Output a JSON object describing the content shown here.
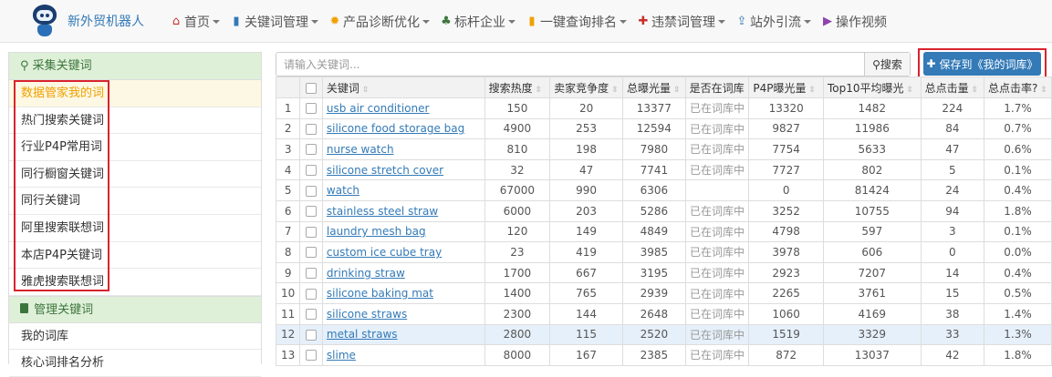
{
  "brand": {
    "name": "新外贸机器人"
  },
  "nav": [
    {
      "label": "首页",
      "icon": "home-icon",
      "glyph": "⌂",
      "color": "#c9302c",
      "caret": true
    },
    {
      "label": "关键词管理",
      "icon": "book-icon",
      "glyph": "▮",
      "color": "#337ab7",
      "caret": true
    },
    {
      "label": "产品诊断优化",
      "icon": "fire-icon",
      "glyph": "✹",
      "color": "#f0a000",
      "caret": true
    },
    {
      "label": "标杆企业",
      "icon": "tree-icon",
      "glyph": "♣",
      "color": "#3c763d",
      "caret": true
    },
    {
      "label": "一键查询排名",
      "icon": "signal-icon",
      "glyph": "▮",
      "color": "#f0a000",
      "caret": true
    },
    {
      "label": "违禁词管理",
      "icon": "medkit-icon",
      "glyph": "✚",
      "color": "#c9302c",
      "caret": true
    },
    {
      "label": "站外引流",
      "icon": "upload-icon",
      "glyph": "⇪",
      "color": "#337ab7",
      "caret": true
    },
    {
      "label": "操作视频",
      "icon": "play-icon",
      "glyph": "▶",
      "color": "#8e44ad",
      "caret": false
    }
  ],
  "sidebar": {
    "collect_title": "采集关键词",
    "collect_items": [
      "数据管家我的词",
      "热门搜索关键词",
      "行业P4P常用词",
      "同行橱窗关键词",
      "同行关键词",
      "阿里搜索联想词",
      "本店P4P关键词",
      "雅虎搜索联想词"
    ],
    "manage_title": "管理关键词",
    "manage_items": [
      "我的词库",
      "核心词排名分析"
    ]
  },
  "search": {
    "placeholder": "请输入关键词...",
    "button": "搜索"
  },
  "save_button": "保存到《我的词库》",
  "table": {
    "columns": [
      "关键词",
      "搜索热度",
      "卖家竞争度",
      "总曝光量",
      "是否在词库",
      "P4P曝光量",
      "Top10平均曝光",
      "总点击量",
      "总点击率?"
    ],
    "rows": [
      [
        "1",
        "usb air conditioner",
        "150",
        "20",
        "13377",
        "已在词库中",
        "13320",
        "1482",
        "224",
        "1.7%"
      ],
      [
        "2",
        "silicone food storage bag",
        "4900",
        "253",
        "12594",
        "已在词库中",
        "9827",
        "11986",
        "84",
        "0.7%"
      ],
      [
        "3",
        "nurse watch",
        "810",
        "198",
        "7980",
        "已在词库中",
        "7754",
        "5633",
        "47",
        "0.6%"
      ],
      [
        "4",
        "silicone stretch cover",
        "32",
        "47",
        "7741",
        "已在词库中",
        "7727",
        "802",
        "5",
        "0.1%"
      ],
      [
        "5",
        "watch",
        "67000",
        "990",
        "6306",
        "",
        "0",
        "81424",
        "24",
        "0.4%"
      ],
      [
        "6",
        "stainless steel straw",
        "6000",
        "203",
        "5286",
        "已在词库中",
        "3252",
        "10755",
        "94",
        "1.8%"
      ],
      [
        "7",
        "laundry mesh bag",
        "120",
        "149",
        "4849",
        "已在词库中",
        "4798",
        "597",
        "3",
        "0.1%"
      ],
      [
        "8",
        "custom ice cube tray",
        "23",
        "419",
        "3985",
        "已在词库中",
        "3978",
        "606",
        "0",
        "0.0%"
      ],
      [
        "9",
        "drinking straw",
        "1700",
        "667",
        "3195",
        "已在词库中",
        "2923",
        "7207",
        "14",
        "0.4%"
      ],
      [
        "10",
        "silicone baking mat",
        "1400",
        "765",
        "2939",
        "已在词库中",
        "2265",
        "3761",
        "15",
        "0.5%"
      ],
      [
        "11",
        "silicone straws",
        "2300",
        "144",
        "2648",
        "已在词库中",
        "1060",
        "4169",
        "38",
        "1.4%"
      ],
      [
        "12",
        "metal straws",
        "2800",
        "115",
        "2520",
        "已在词库中",
        "1519",
        "3329",
        "33",
        "1.3%"
      ],
      [
        "13",
        "slime",
        "8000",
        "167",
        "2385",
        "已在词库中",
        "872",
        "13037",
        "42",
        "1.8%"
      ]
    ]
  },
  "colors": {
    "primary": "#337ab7",
    "highlight": "#d9232e",
    "panel": "#dff0d8"
  }
}
